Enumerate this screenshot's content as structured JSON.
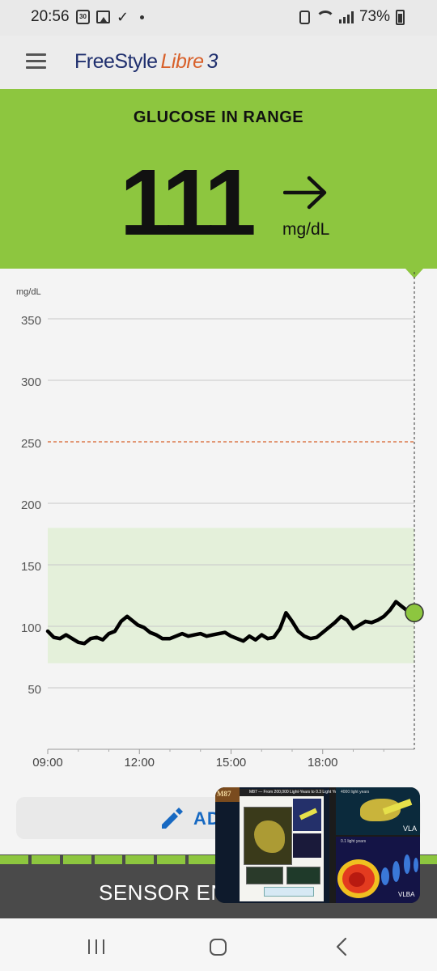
{
  "status_bar": {
    "time": "20:56",
    "calendar_day": "30",
    "battery": "73%",
    "icons": [
      "calendar-icon",
      "gallery-icon",
      "check-icon",
      "dot-icon",
      "lock-icon",
      "wifi-icon",
      "signal-icon",
      "battery-icon"
    ]
  },
  "app_bar": {
    "logo_freestyle": "FreeStyle",
    "logo_libre": "Libre",
    "logo_3": "3",
    "menu_icon": "hamburger-menu-icon"
  },
  "banner": {
    "title": "GLUCOSE IN RANGE",
    "value": "111",
    "unit": "mg/dL",
    "trend": "steady-arrow-icon",
    "color": "#8dc63f"
  },
  "chart_data": {
    "type": "line",
    "ylabel": "mg/dL",
    "ylim": [
      0,
      350
    ],
    "y_ticks": [
      "350",
      "300",
      "250",
      "200",
      "150",
      "100",
      "50"
    ],
    "x_ticks": [
      "09:00",
      "12:00",
      "15:00",
      "18:00"
    ],
    "target_range": [
      70,
      180
    ],
    "high_threshold": 250,
    "x_hours": [
      9.0,
      9.2,
      9.4,
      9.6,
      9.8,
      10.0,
      10.2,
      10.4,
      10.6,
      10.8,
      11.0,
      11.2,
      11.4,
      11.6,
      11.8,
      11.95,
      12.15,
      12.35,
      12.55,
      12.75,
      13.0,
      13.2,
      13.4,
      13.6,
      13.8,
      14.0,
      14.2,
      14.4,
      14.6,
      14.8,
      15.0,
      15.2,
      15.4,
      15.6,
      15.8,
      16.0,
      16.2,
      16.4,
      16.6,
      16.8,
      17.0,
      17.2,
      17.4,
      17.6,
      17.8,
      18.0,
      18.2,
      18.4,
      18.6,
      18.8,
      19.0,
      19.2,
      19.4,
      19.6,
      19.8,
      20.0,
      20.2,
      20.4,
      20.6,
      20.75,
      20.9
    ],
    "values": [
      96,
      91,
      90,
      93,
      90,
      87,
      86,
      90,
      91,
      89,
      94,
      96,
      104,
      108,
      104,
      101,
      99,
      95,
      93,
      90,
      90,
      92,
      94,
      92,
      93,
      94,
      92,
      93,
      94,
      95,
      92,
      90,
      88,
      92,
      89,
      93,
      90,
      91,
      98,
      111,
      104,
      96,
      92,
      90,
      91,
      95,
      99,
      103,
      108,
      105,
      98,
      101,
      104,
      103,
      105,
      108,
      113,
      120,
      116,
      113,
      111
    ],
    "colors": {
      "line": "#000000",
      "range_fill": "#e4f0da",
      "high_line": "#d8602a",
      "current_point": "#8dc63f"
    }
  },
  "add_note": {
    "label": "AD",
    "icon": "pencil-icon"
  },
  "sensor": {
    "label": "SENSOR END",
    "segments": 14
  },
  "pip_overlay": {
    "tag": "M87",
    "doc_title": "M87 — From 200,000 Light-Years to 0.3 Light Year",
    "top_label": "4000 light years",
    "top_caption": "VLA",
    "bottom_label": "0.1 light years",
    "bottom_caption": "VLBA"
  },
  "nav_bar": {
    "icons": [
      "recent-apps-icon",
      "home-icon",
      "back-icon"
    ]
  }
}
